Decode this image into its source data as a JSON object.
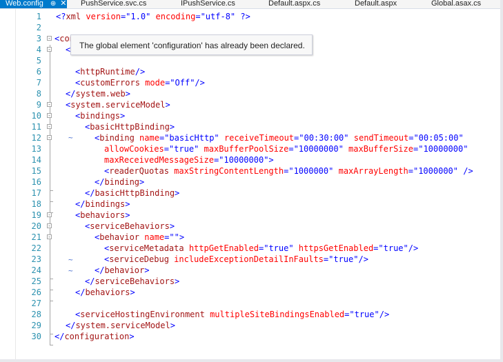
{
  "tabs": [
    {
      "label": "Web.config",
      "active": true,
      "pin": "pin-icon",
      "close": "close-icon"
    },
    {
      "label": "PushService.svc.cs"
    },
    {
      "label": "IPushService.cs"
    },
    {
      "label": "Default.aspx.cs"
    },
    {
      "label": "Default.aspx"
    },
    {
      "label": "Global.asax.cs"
    }
  ],
  "tooltip": "The global element 'configuration' has already been declared.",
  "lines": {
    "n1": "1",
    "n2": "2",
    "n3": "3",
    "n4": "4",
    "n5": "5",
    "n6": "6",
    "n7": "7",
    "n8": "8",
    "n9": "9",
    "n10": "10",
    "n11": "11",
    "n12": "12",
    "n13": "13",
    "n14": "14",
    "n15": "15",
    "n16": "16",
    "n17": "17",
    "n18": "18",
    "n19": "19",
    "n20": "20",
    "n21": "21",
    "n22": "22",
    "n23": "23",
    "n24": "24",
    "n25": "25",
    "n26": "26",
    "n27": "27",
    "n28": "28",
    "n29": "29",
    "n30": "30"
  },
  "code": {
    "l1_open": "<?",
    "l1_tag": "xml",
    "l1_a1": " version",
    "l1_eq1": "=\"",
    "l1_v1": "1.0",
    "l1_q1": "\"",
    "l1_a2": " encoding",
    "l1_eq2": "=\"",
    "l1_v2": "utf-8",
    "l1_q2": "\"",
    "l1_close": " ?>",
    "l3_lt": "<",
    "l3_tag": "configuration",
    "l3_gt": ">",
    "l4_lt": "<",
    "l6_lt": "<",
    "l6_tag": "httpRuntime",
    "l6_gt": "/>",
    "l7_lt": "<",
    "l7_tag": "customErrors",
    "l7_a1": " mode",
    "l7_eq": "=\"",
    "l7_v1": "Off",
    "l7_end": "\"/>",
    "l8_lt": "</",
    "l8_tag": "system.web",
    "l8_gt": ">",
    "l9_lt": "<",
    "l9_tag": "system.serviceModel",
    "l9_gt": ">",
    "l10_lt": "<",
    "l10_tag": "bindings",
    "l10_gt": ">",
    "l11_lt": "<",
    "l11_tag": "basicHttpBinding",
    "l11_gt": ">",
    "l12_lt": "<",
    "l12_tag": "binding",
    "l12_a1": " name",
    "l12_v1": "basicHttp",
    "l12_a2": " receiveTimeout",
    "l12_v2": "00:30:00",
    "l12_a3": " sendTimeout",
    "l12_v3": "00:05:00",
    "l13_a1": "allowCookies",
    "l13_v1": "true",
    "l13_a2": " maxBufferPoolSize",
    "l13_v2": "10000000",
    "l13_a3": " maxBufferSize",
    "l13_v3": "10000000",
    "l14_a1": "maxReceivedMessageSize",
    "l14_v1": "10000000",
    "l15_lt": "<",
    "l15_tag": "readerQuotas",
    "l15_a1": " maxStringContentLength",
    "l15_v1": "1000000",
    "l15_a2": " maxArrayLength",
    "l15_v2": "1000000",
    "l15_end": "\" />",
    "l16_lt": "</",
    "l16_tag": "binding",
    "l16_gt": ">",
    "l17_lt": "</",
    "l17_tag": "basicHttpBinding",
    "l17_gt": ">",
    "l18_lt": "</",
    "l18_tag": "bindings",
    "l18_gt": ">",
    "l19_lt": "<",
    "l19_tag": "behaviors",
    "l19_gt": ">",
    "l20_lt": "<",
    "l20_tag": "serviceBehaviors",
    "l20_gt": ">",
    "l21_lt": "<",
    "l21_tag": "behavior",
    "l21_a1": " name",
    "l21_v1": "",
    "l21_end": "\">",
    "l22_lt": "<",
    "l22_tag": "serviceMetadata",
    "l22_a1": " httpGetEnabled",
    "l22_v1": "true",
    "l22_a2": " httpsGetEnabled",
    "l22_v2": "true",
    "l22_end": "\"/>",
    "l23_lt": "<",
    "l23_tag": "serviceDebug",
    "l23_a1": " includeExceptionDetailInFaults",
    "l23_v1": "true",
    "l23_end": "\"/>",
    "l24_lt": "</",
    "l24_tag": "behavior",
    "l24_gt": ">",
    "l25_lt": "</",
    "l25_tag": "serviceBehaviors",
    "l25_gt": ">",
    "l26_lt": "</",
    "l26_tag": "behaviors",
    "l26_gt": ">",
    "l28_lt": "<",
    "l28_tag": "serviceHostingEnvironment",
    "l28_a1": " multipleSiteBindingsEnabled",
    "l28_v1": "true",
    "l28_end": "\"/>",
    "l29_lt": "</",
    "l29_tag": "system.serviceModel",
    "l29_gt": ">",
    "l30_lt": "</",
    "l30_tag": "configuration",
    "l30_gt": ">",
    "eqq": "=\"",
    "q": "\""
  },
  "squiggle": "~",
  "colors": {
    "keyword": "#0000ff",
    "tag": "#a31515",
    "attribute": "#ff0000",
    "line_number": "#2b91af",
    "active_tab": "#007acc"
  }
}
